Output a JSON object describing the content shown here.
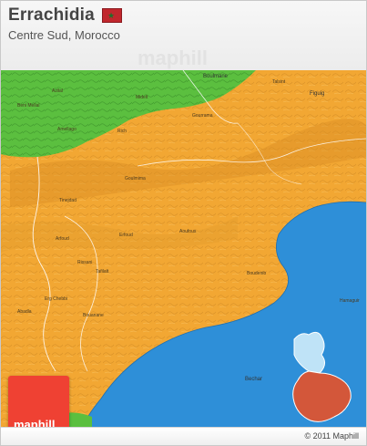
{
  "header": {
    "title": "Errachidia",
    "subtitle": "Centre Sud, Morocco",
    "watermark": "maphill"
  },
  "footer": {
    "copyright": "© 2011 Maphill"
  },
  "logo": {
    "text": "maphill"
  },
  "map": {
    "colors": {
      "land": "#f2a733",
      "green_region": "#5bbf3f",
      "water": "#2e8fd8",
      "inset_light": "#bfe3f7",
      "inset_dark": "#d3573a"
    },
    "labels": {
      "boulmane": "Boulmane",
      "figuig": "Figuig",
      "bechar": "Bechar",
      "hamaguir": "Hamaguir",
      "aoufous": "Aoufous",
      "arfoud": "Arfoud",
      "erfoud": "Erfoud",
      "goulmima": "Goulmima",
      "rissani": "Rissani",
      "boudenib": "Boudenib",
      "bouanane": "Bouanane",
      "midelt": "Midelt",
      "rich": "Rich",
      "tinejdad": "Tinejdad",
      "gourrama": "Gourrama",
      "amellago": "Amellago",
      "beni_mellal": "Beni Mellal",
      "azilal": "Azilal",
      "talsint": "Talsint",
      "abadla": "Abadla",
      "erg": "Erg Chebbi",
      "tafilalt": "Tafilalt"
    }
  }
}
